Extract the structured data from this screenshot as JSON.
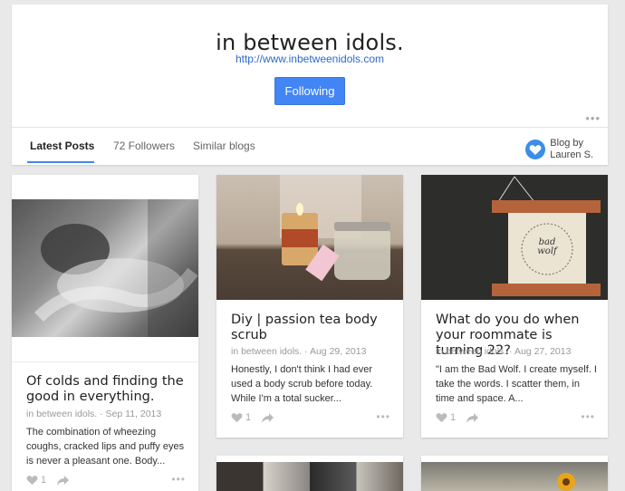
{
  "header": {
    "title": "in between idols.",
    "url": "http://www.inbetweenidols.com",
    "follow_label": "Following",
    "more": "•••"
  },
  "tabs": [
    {
      "label": "Latest Posts"
    },
    {
      "label": "72 Followers"
    },
    {
      "label": "Similar blogs"
    }
  ],
  "author": {
    "line1": "Blog by",
    "line2": "Lauren S."
  },
  "posts": [
    {
      "title": "Of colds and finding the good in everything.",
      "meta": "in between idols. · Sep 11, 2013",
      "snippet": "The combination of wheezing coughs, cracked lips and puffy eyes is never a pleasant one. Body...",
      "likes": "1",
      "more": "•••"
    },
    {
      "title": "Diy | passion tea body scrub",
      "meta": "in between idols. · Aug 29, 2013",
      "snippet": "Honestly, I don't think I had ever used a body scrub before today. While I'm a total sucker...",
      "likes": "1",
      "more": "•••"
    },
    {
      "title": "What do you do when your roommate is turning 22?",
      "meta": "in between idols. · Aug 27, 2013",
      "snippet": "\"I am the Bad Wolf. I create myself. I take the words. I scatter them, in time and space. A...",
      "likes": "1",
      "more": "•••",
      "image_text": "bad wolf"
    }
  ],
  "colors": {
    "accent": "#4285f4",
    "link": "#2f69c9",
    "background": "#e9e9e9"
  }
}
